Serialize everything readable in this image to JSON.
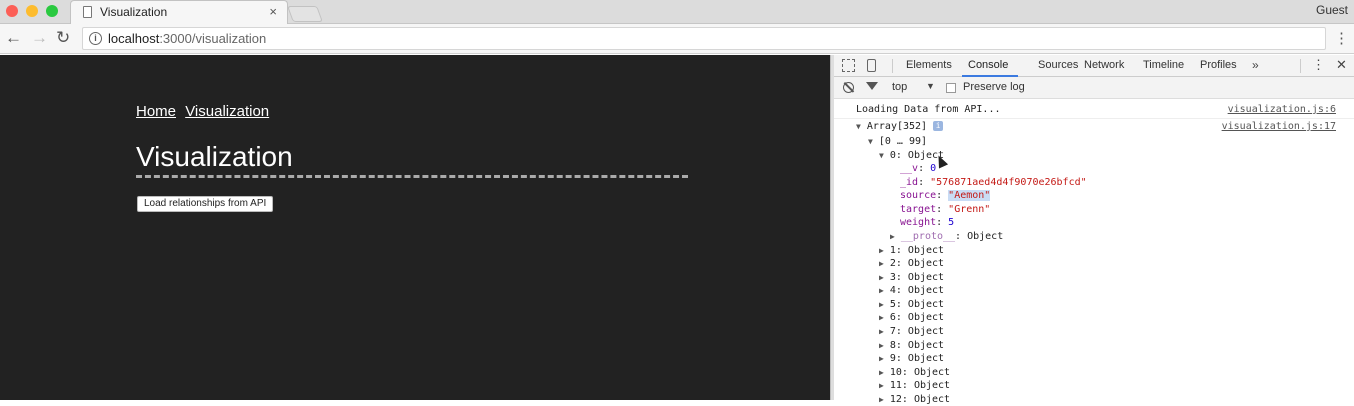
{
  "browser": {
    "tab_title": "Visualization",
    "tab_close": "×",
    "profile": "Guest",
    "url_host": "localhost",
    "url_path": ":3000/visualization",
    "menu_glyph": "⋮"
  },
  "page": {
    "nav_links": [
      "Home",
      "Visualization"
    ],
    "title": "Visualization",
    "load_button": "Load relationships from API"
  },
  "devtools": {
    "tabs": [
      "Elements",
      "Console",
      "Sources",
      "Network",
      "Timeline",
      "Profiles"
    ],
    "active_tab": "Console",
    "more_glyph": "»",
    "context": "top",
    "preserve_log": "Preserve log",
    "messages": [
      {
        "text": "Loading Data from API...",
        "source": "visualization.js:6"
      },
      {
        "text": "Array[352]",
        "source": "visualization.js:17"
      }
    ],
    "tree": {
      "range": "[0 … 99]",
      "item0": "0: Object",
      "fields": [
        {
          "key": "__v",
          "value": "0",
          "kind": "num"
        },
        {
          "key": "_id",
          "value": "\"576871aed4d4f9070e26bfcd\"",
          "kind": "str"
        },
        {
          "key": "source",
          "value": "\"Aemon\"",
          "kind": "str"
        },
        {
          "key": "target",
          "value": "\"Grenn\"",
          "kind": "str"
        },
        {
          "key": "weight",
          "value": "5",
          "kind": "num"
        }
      ],
      "proto": "__proto__",
      "proto_value": "Object",
      "collapsed": [
        "1: Object",
        "2: Object",
        "3: Object",
        "4: Object",
        "5: Object",
        "6: Object",
        "7: Object",
        "8: Object",
        "9: Object",
        "10: Object",
        "11: Object",
        "12: Object"
      ]
    }
  }
}
